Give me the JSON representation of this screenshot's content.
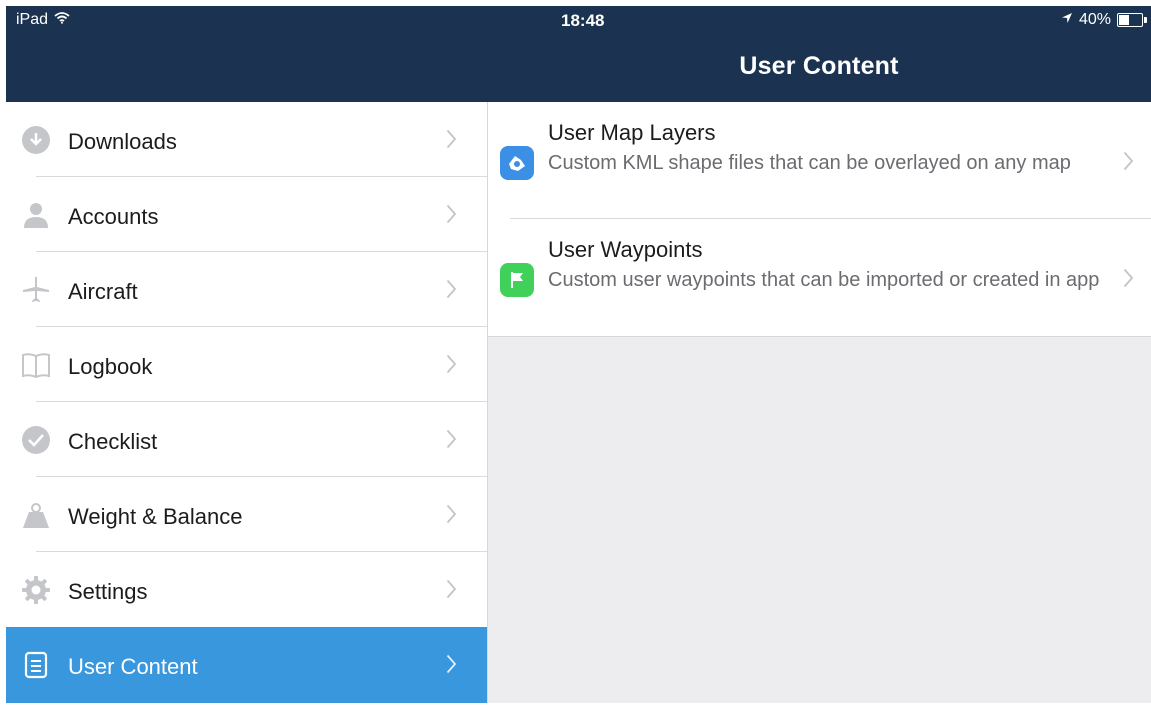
{
  "status": {
    "device": "iPad",
    "time": "18:48",
    "battery": "40%",
    "battery_level": 0.4
  },
  "nav": {
    "title": "User Content"
  },
  "colors": {
    "navbar": "#1b3350",
    "accent": "#3897dd",
    "map_layers_icon": "#3b8fe4",
    "waypoints_icon": "#3fd15a"
  },
  "sidebar": {
    "items": [
      {
        "label": "Downloads",
        "icon": "download-icon"
      },
      {
        "label": "Accounts",
        "icon": "person-icon"
      },
      {
        "label": "Aircraft",
        "icon": "airplane-icon"
      },
      {
        "label": "Logbook",
        "icon": "book-icon"
      },
      {
        "label": "Checklist",
        "icon": "checkmark-icon"
      },
      {
        "label": "Weight & Balance",
        "icon": "weight-icon"
      },
      {
        "label": "Settings",
        "icon": "gear-icon"
      },
      {
        "label": "User Content",
        "icon": "document-icon",
        "selected": true
      }
    ]
  },
  "detail": {
    "rows": [
      {
        "title": "User Map Layers",
        "description": "Custom KML shape files that can be overlayed on any map",
        "icon": "map-layers-icon"
      },
      {
        "title": "User Waypoints",
        "description": "Custom user waypoints that can be imported or created in app",
        "icon": "flag-icon"
      }
    ]
  }
}
